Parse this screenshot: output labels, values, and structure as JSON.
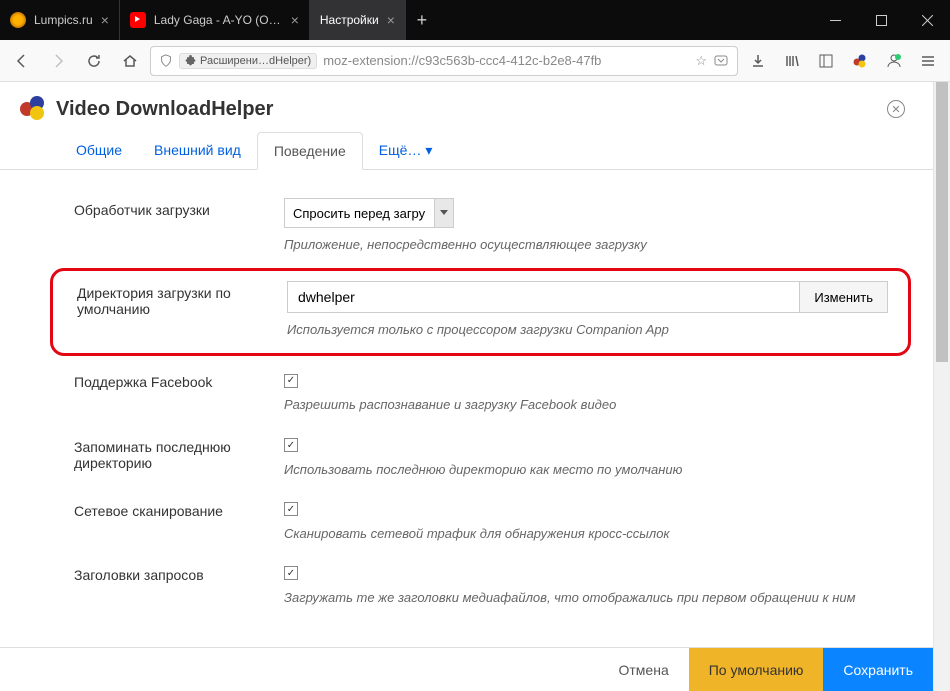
{
  "window": {
    "tabs": [
      {
        "label": "Lumpics.ru",
        "icon": "lumpics"
      },
      {
        "label": "Lady Gaga - A-YO (Official Au",
        "icon": "youtube"
      },
      {
        "label": "Настройки",
        "icon": "none",
        "active": true
      }
    ]
  },
  "urlbar": {
    "badge": "Расширени…dHelper)",
    "url": "moz-extension://c93c563b-ccc4-412c-b2e8-47fb"
  },
  "page": {
    "title": "Video DownloadHelper"
  },
  "tabs": {
    "general": "Общие",
    "appearance": "Внешний вид",
    "behavior": "Поведение",
    "more": "Ещё…"
  },
  "settings": {
    "handler": {
      "label": "Обработчик загрузки",
      "value": "Спросить перед загру",
      "help": "Приложение, непосредственно осуществляющее загрузку"
    },
    "directory": {
      "label": "Директория загрузки по умолчанию",
      "value": "dwhelper",
      "button": "Изменить",
      "help": "Используется только с процессором загрузки Companion App"
    },
    "facebook": {
      "label": "Поддержка Facebook",
      "help": "Разрешить распознавание и загрузку Facebook видео"
    },
    "lastdir": {
      "label": "Запоминать последнюю директорию",
      "help": "Использовать последнюю директорию как место по умолчанию"
    },
    "netscan": {
      "label": "Сетевое сканирование",
      "help": "Сканировать сетевой трафик для обнаружения кросс-ссылок"
    },
    "headers": {
      "label": "Заголовки запросов",
      "help": "Загружать те же заголовки медиафайлов, что отображались при первом обращении к ним"
    }
  },
  "footer": {
    "cancel": "Отмена",
    "default": "По умолчанию",
    "save": "Сохранить"
  },
  "glyphs": {
    "check": "✓"
  }
}
